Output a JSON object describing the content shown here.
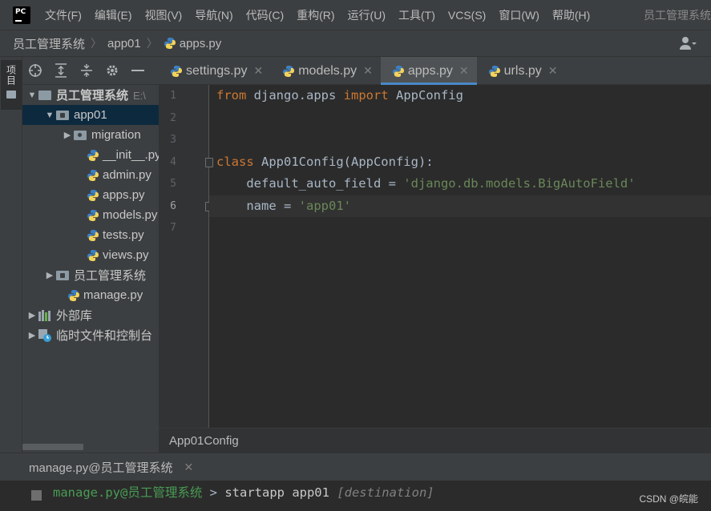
{
  "menu": {
    "items": [
      "文件(F)",
      "编辑(E)",
      "视图(V)",
      "导航(N)",
      "代码(C)",
      "重构(R)",
      "运行(U)",
      "工具(T)",
      "VCS(S)",
      "窗口(W)",
      "帮助(H)"
    ],
    "window_title": "员工管理系统"
  },
  "breadcrumb": [
    "员工管理系统",
    "app01",
    "apps.py"
  ],
  "left_stripe": {
    "project_label": "项目"
  },
  "project_tree": {
    "rows": [
      {
        "label": "员工管理系统",
        "hint": "E:\\"
      },
      {
        "label": "app01"
      },
      {
        "label": "migration"
      },
      {
        "label": "__init__.py"
      },
      {
        "label": "admin.py"
      },
      {
        "label": "apps.py"
      },
      {
        "label": "models.py"
      },
      {
        "label": "tests.py"
      },
      {
        "label": "views.py"
      },
      {
        "label": "员工管理系统"
      },
      {
        "label": "manage.py"
      },
      {
        "label": "外部库"
      },
      {
        "label": "临时文件和控制台"
      }
    ]
  },
  "tabs": [
    {
      "label": "settings.py",
      "active": false
    },
    {
      "label": "models.py",
      "active": false
    },
    {
      "label": "apps.py",
      "active": true
    },
    {
      "label": "urls.py",
      "active": false
    }
  ],
  "editor": {
    "line_numbers": [
      "1",
      "2",
      "3",
      "4",
      "5",
      "6",
      "7"
    ],
    "current_line": "6",
    "code": {
      "l1_kw1": "from",
      "l1_mid": " django.apps ",
      "l1_kw2": "import",
      "l1_end": " AppConfig",
      "l4_kw": "class",
      "l4_rest": " App01Config(AppConfig):",
      "l5_pre": "    default_auto_field = ",
      "l5_str": "'django.db.models.BigAutoField'",
      "l6_pre": "    name = ",
      "l6_str": "'app01'"
    },
    "structure_crumb": "App01Config"
  },
  "terminal": {
    "tab_label": "manage.py@员工管理系统",
    "prompt_path": "manage.py@员工管理系统",
    "prompt_arrow": " > ",
    "command": "startapp app01 ",
    "hint": "[destination]",
    "watermark": "CSDN @皖能"
  },
  "colors": {
    "keyword": "#cc7832",
    "string": "#6a8759",
    "prompt": "#499c54",
    "active_tab_underline": "#4a88c7",
    "selection": "#0d293e"
  },
  "icons": {
    "close": "close-icon",
    "chevron": "chevron-icon",
    "python_file": "python-file-icon"
  }
}
